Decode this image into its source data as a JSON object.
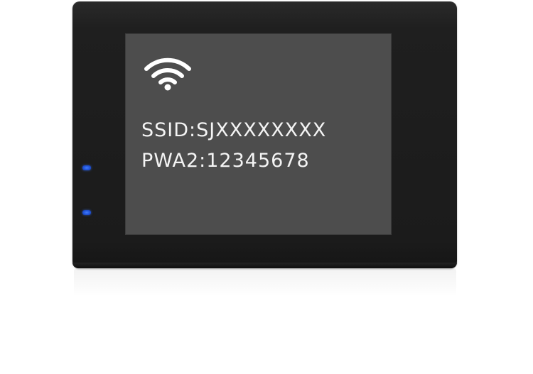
{
  "screen": {
    "ssid_line": "SSID:SJXXXXXXXX",
    "password_line": "PWA2:12345678",
    "icon": "wifi-icon"
  },
  "indicators": [
    {
      "name": "status-led-top",
      "color": "#2f63e6"
    },
    {
      "name": "status-led-bottom",
      "color": "#2f63e6"
    }
  ],
  "colors": {
    "device_body": "#1b1b1b",
    "screen_background": "#4d4d4d",
    "screen_text": "#f4f4f4",
    "led": "#2f63e6"
  }
}
